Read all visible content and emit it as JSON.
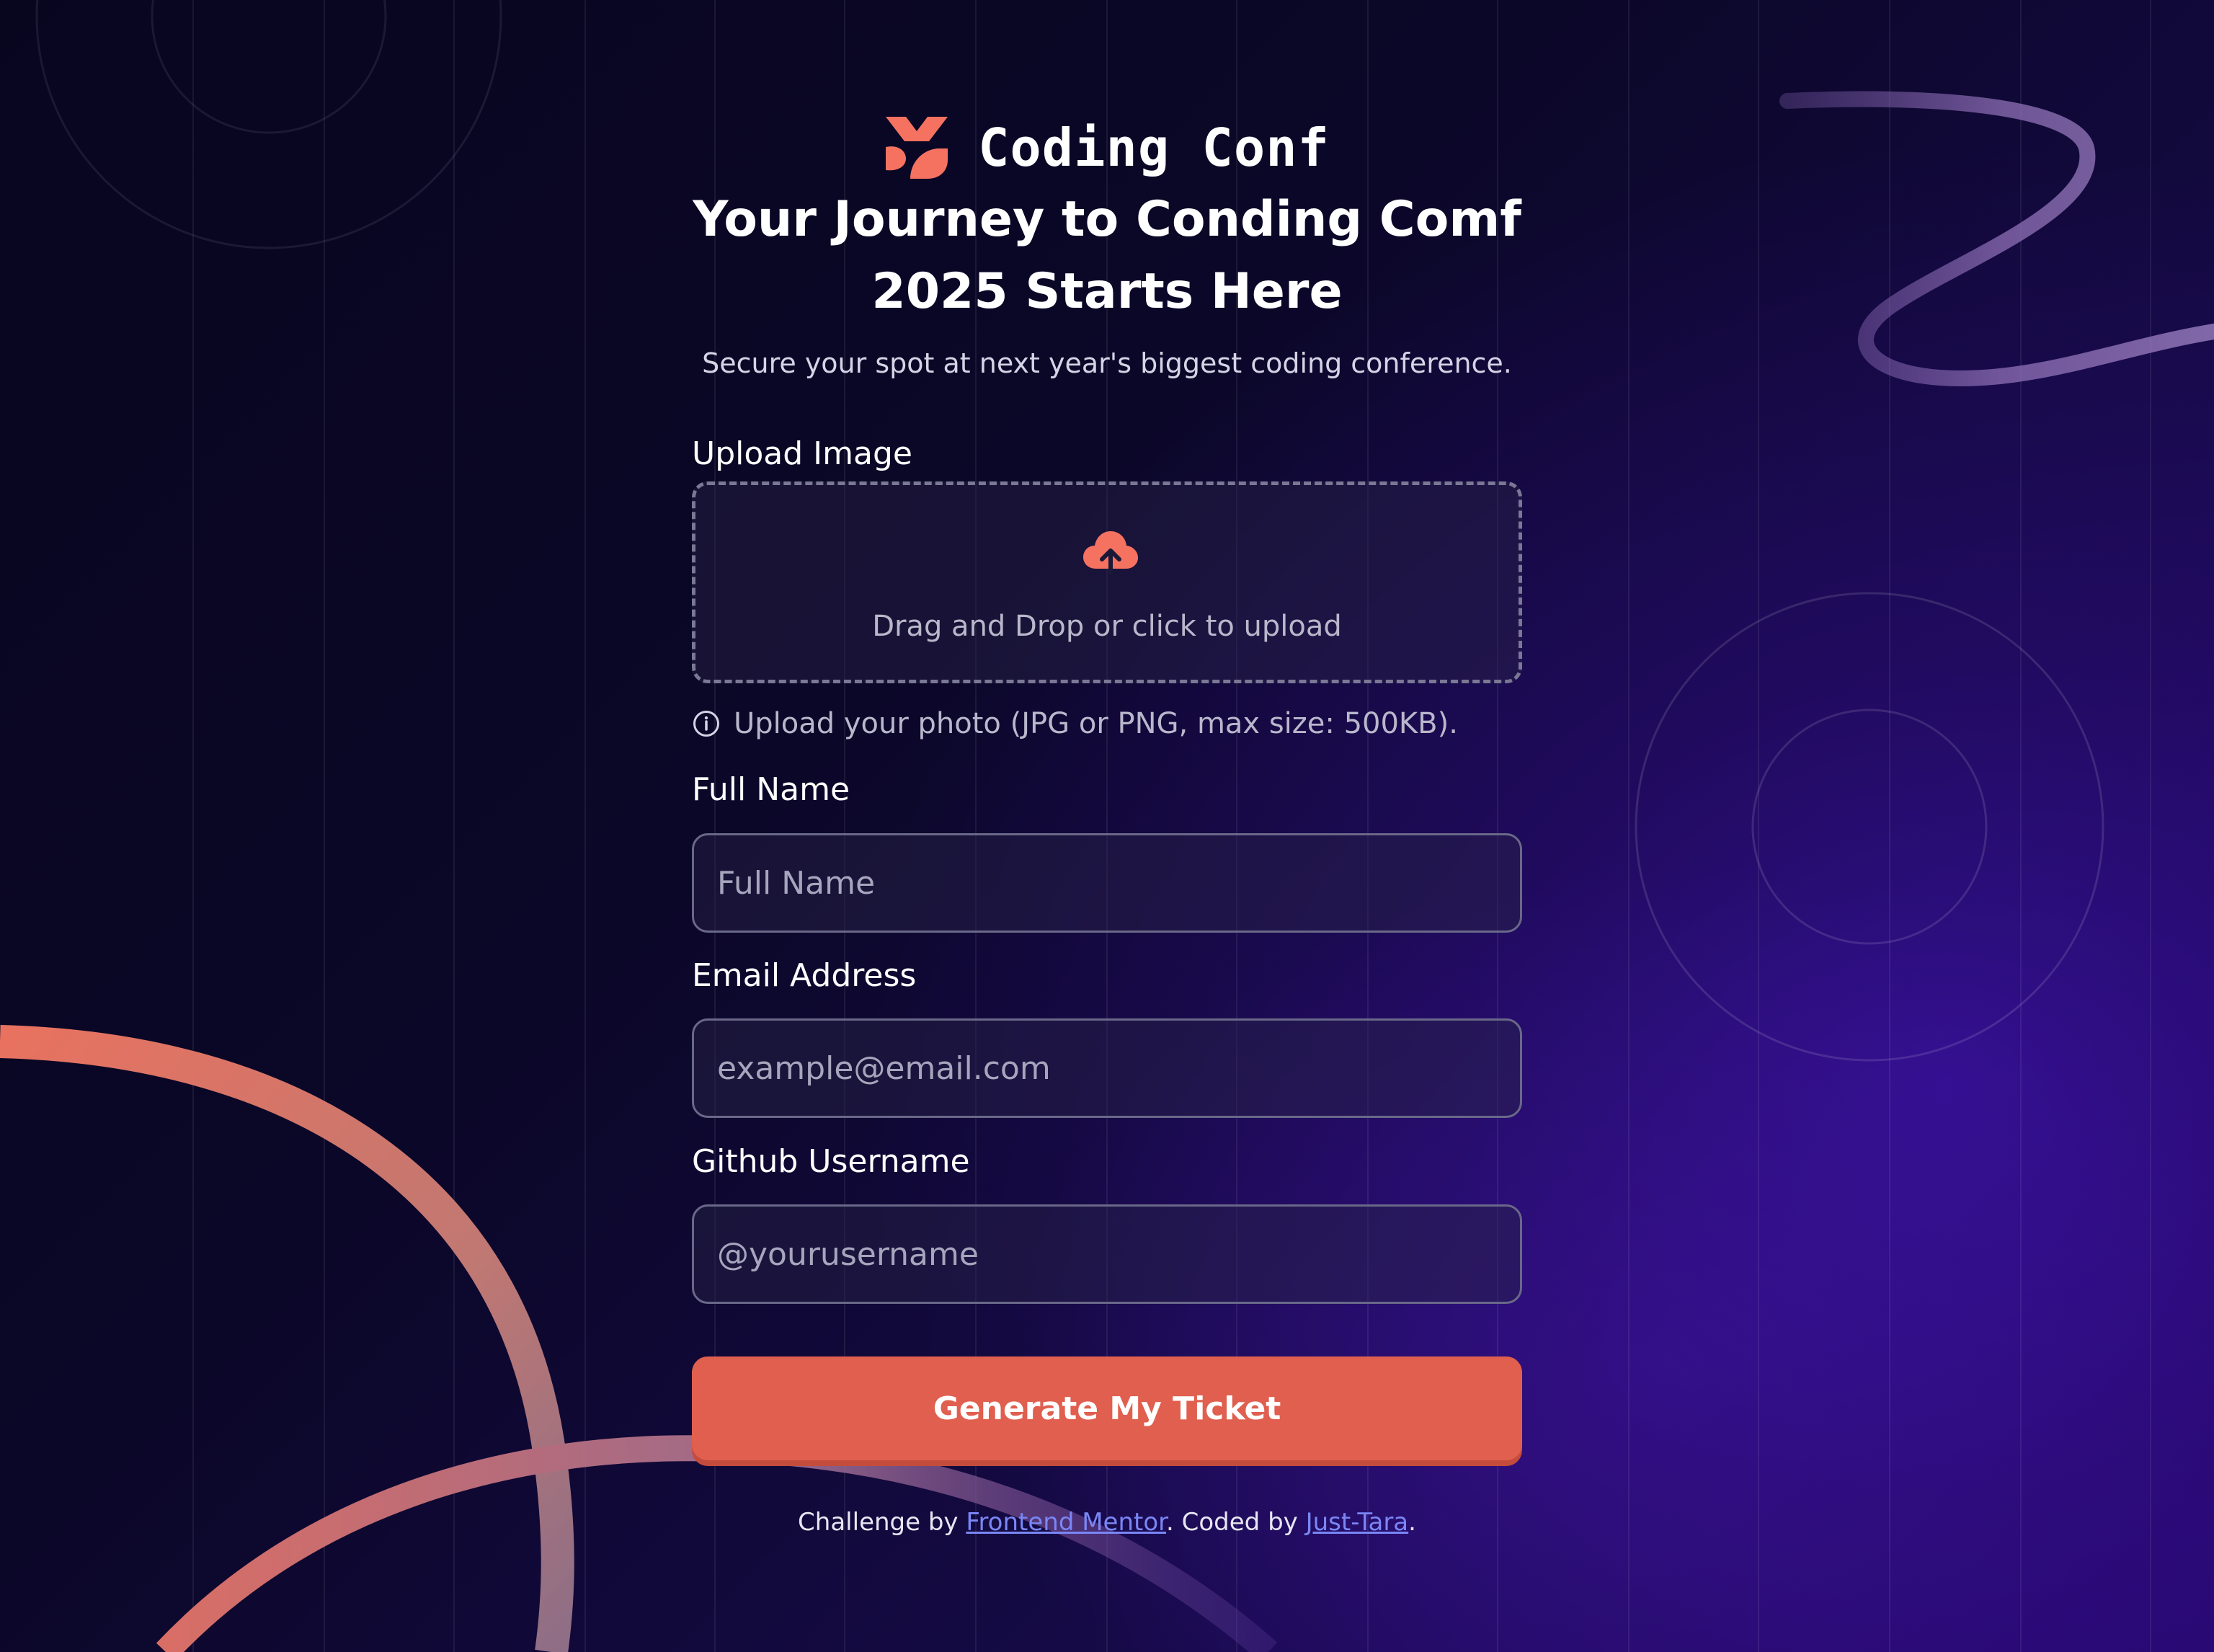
{
  "brand": {
    "name": "Coding Conf",
    "accent_color": "#f57261"
  },
  "hero": {
    "headline_line1": "Your Journey to Conding Comf",
    "headline_line2": "2025 Starts Here",
    "subtitle": "Secure your spot at next year's biggest coding conference."
  },
  "form": {
    "upload": {
      "label": "Upload Image",
      "dropzone_text": "Drag and Drop or click to upload",
      "hint": "Upload your photo (JPG or PNG, max size: 500KB).",
      "icon": "cloud-upload-icon"
    },
    "full_name": {
      "label": "Full Name",
      "placeholder": "Full Name",
      "value": ""
    },
    "email": {
      "label": "Email Address",
      "placeholder": "example@email.com",
      "value": ""
    },
    "github": {
      "label": "Github Username",
      "placeholder": "@yourusername",
      "value": ""
    },
    "submit_label": "Generate My Ticket",
    "button_color": "#e05f4f"
  },
  "footer": {
    "prefix": "Challenge by ",
    "link1": "Frontend Mentor",
    "middle": ". Coded by ",
    "link2": "Just-Tara",
    "suffix": ".",
    "link_color": "#7a86f5"
  }
}
